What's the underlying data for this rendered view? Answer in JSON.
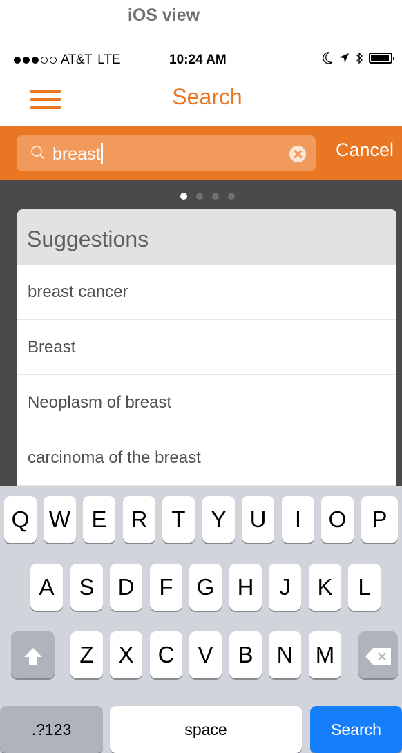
{
  "caption": "iOS view",
  "status_bar": {
    "carrier": "AT&T",
    "network": "LTE",
    "time": "10:24 AM"
  },
  "nav": {
    "title": "Search"
  },
  "search": {
    "query": "breast",
    "cancel_label": "Cancel"
  },
  "suggestions": {
    "header": "Suggestions",
    "items": [
      "breast cancer",
      "Breast",
      "Neoplasm of breast",
      "carcinoma of the breast"
    ]
  },
  "keyboard": {
    "row1": [
      "Q",
      "W",
      "E",
      "R",
      "T",
      "Y",
      "U",
      "I",
      "O",
      "P"
    ],
    "row2": [
      "A",
      "S",
      "D",
      "F",
      "G",
      "H",
      "J",
      "K",
      "L"
    ],
    "row3": [
      "Z",
      "X",
      "C",
      "V",
      "B",
      "N",
      "M"
    ],
    "numbers_label": ".?123",
    "space_label": "space",
    "return_label": "Search"
  },
  "colors": {
    "accent": "#e97622",
    "search_field": "#f29a5b",
    "return_key": "#167efb"
  },
  "icons": [
    "menu-icon",
    "search-icon",
    "clear-icon",
    "moon-icon",
    "location-arrow-icon",
    "bluetooth-icon",
    "battery-icon",
    "shift-icon",
    "backspace-icon"
  ]
}
